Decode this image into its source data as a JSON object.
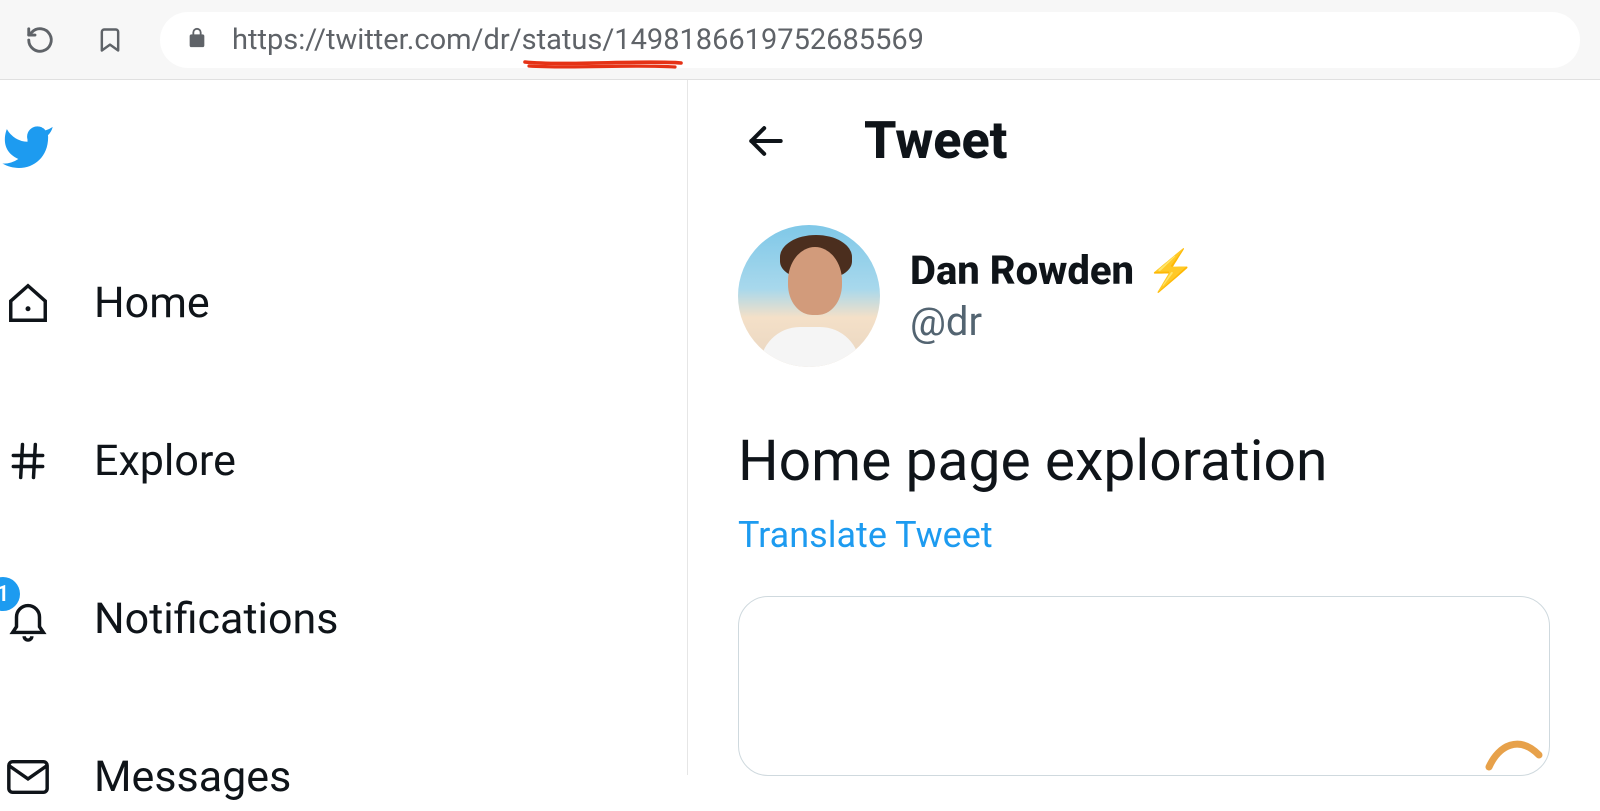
{
  "browser": {
    "url": "https://twitter.com/dr/status/1498186619752685569"
  },
  "sidebar": {
    "items": [
      {
        "label": "Home"
      },
      {
        "label": "Explore"
      },
      {
        "label": "Notifications",
        "badge": "1"
      },
      {
        "label": "Messages"
      }
    ]
  },
  "header": {
    "title": "Tweet"
  },
  "tweet": {
    "author": {
      "name": "Dan Rowden",
      "handle": "@dr",
      "emoji": "⚡"
    },
    "text": "Home page exploration",
    "translate_label": "Translate Tweet"
  }
}
